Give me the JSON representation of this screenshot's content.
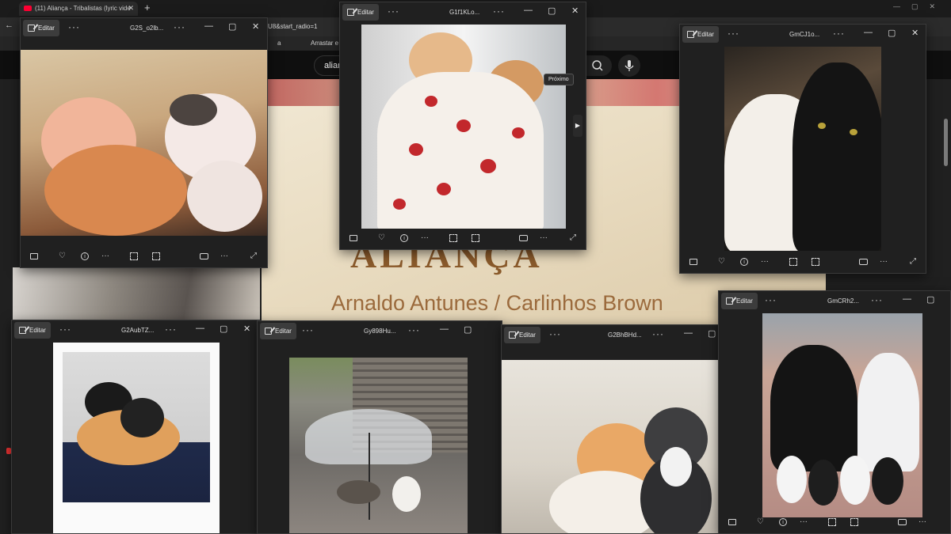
{
  "browser": {
    "tab_title": "(11) Aliança - Tribalistas (lyric vide",
    "address_fragment": "U8&start_radio=1",
    "bookmark_a": "a",
    "bookmark_drag": "Arrastar e s",
    "search_value": "alian"
  },
  "video": {
    "title": "ALIANÇA",
    "subtitle": "Arnaldo Antunes / Carlinhos Brown"
  },
  "viewer": {
    "edit_label": "Editar",
    "tooltip_next": "Próximo"
  },
  "windows": {
    "w1": {
      "filename": "G2S_o2lb..."
    },
    "w2": {
      "filename": "G1f1KLo..."
    },
    "w3": {
      "filename": "GmCJ1o..."
    },
    "w4": {
      "filename": "G2AubTZ..."
    },
    "w5": {
      "filename": "Gy898Hu..."
    },
    "w6": {
      "filename": "G2BhBHd..."
    },
    "w7": {
      "filename": "GmCRh2..."
    }
  },
  "colors": {
    "viewer_bg": "#202020",
    "video_title": "#8a5a2b",
    "youtube_red": "#ff0033"
  },
  "icons": [
    "youtube-icon",
    "search-icon",
    "mic-icon",
    "edit-icon",
    "more-icon",
    "minimize-icon",
    "maximize-icon",
    "close-icon",
    "filmstrip-icon",
    "heart-icon",
    "info-icon",
    "zoom-icon",
    "crop-icon",
    "camera-icon",
    "fullscreen-icon",
    "next-arrow-icon"
  ]
}
